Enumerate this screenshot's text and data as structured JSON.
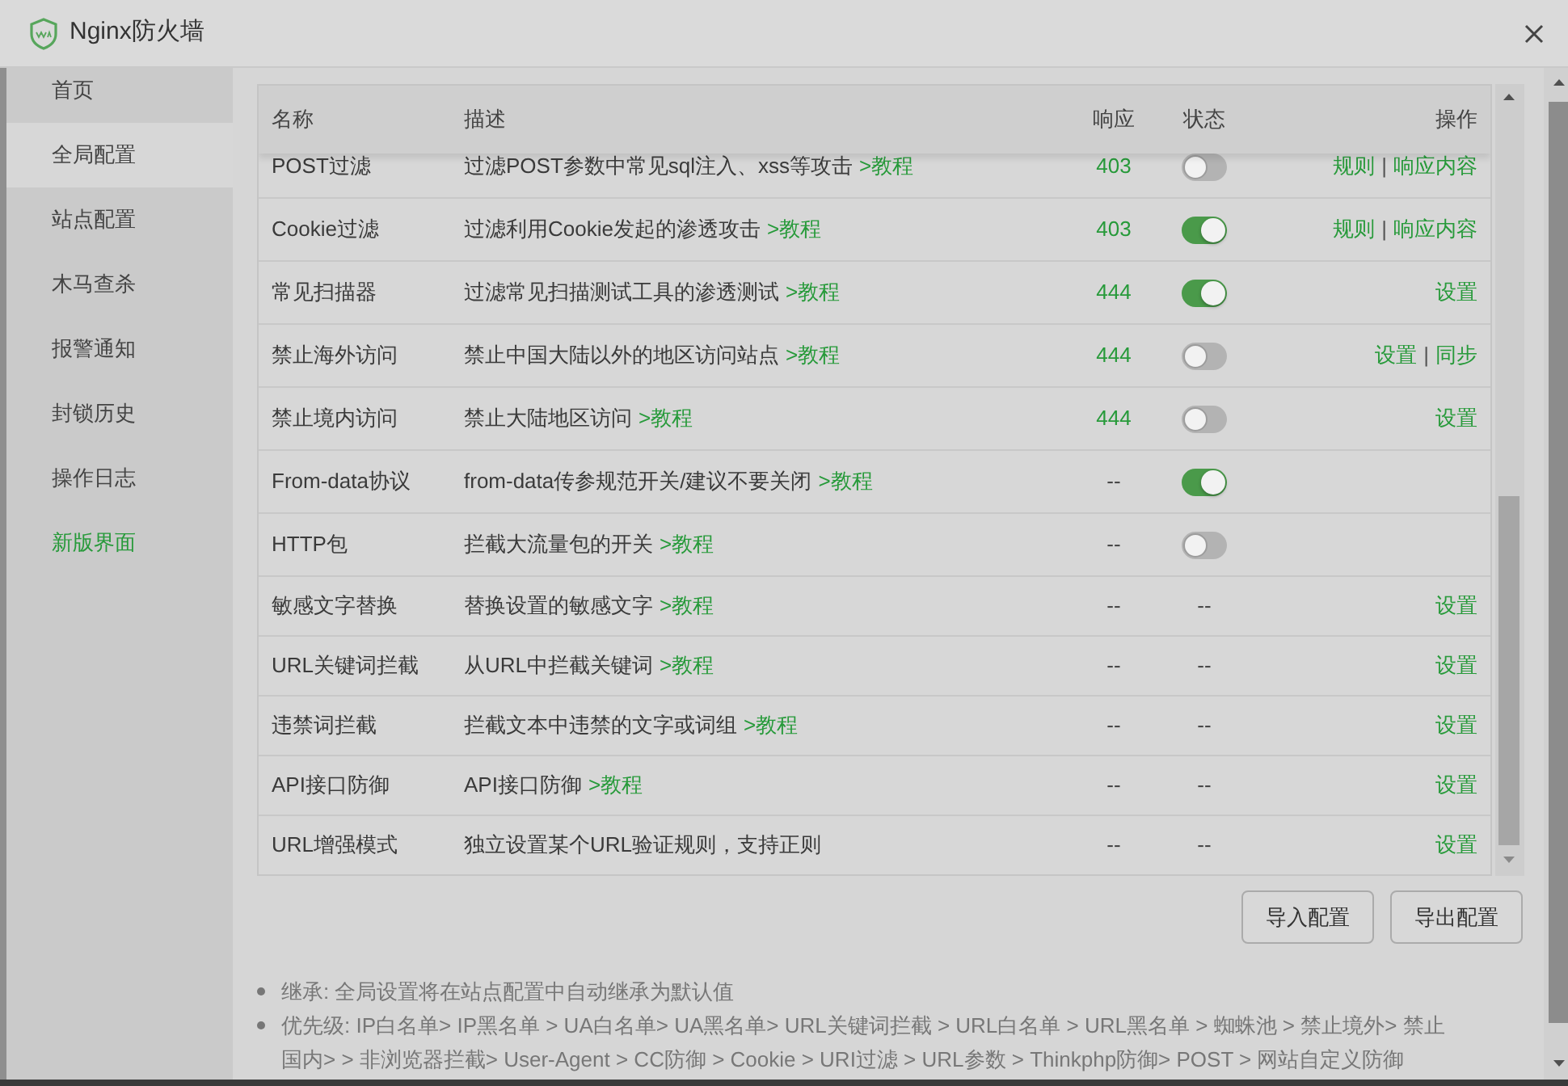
{
  "window": {
    "title": "Nginx防火墙"
  },
  "sidebar": {
    "items": [
      {
        "label": "首页",
        "selected": false,
        "highlighted": false
      },
      {
        "label": "全局配置",
        "selected": true,
        "highlighted": false
      },
      {
        "label": "站点配置",
        "selected": false,
        "highlighted": false
      },
      {
        "label": "木马查杀",
        "selected": false,
        "highlighted": false
      },
      {
        "label": "报警通知",
        "selected": false,
        "highlighted": false
      },
      {
        "label": "封锁历史",
        "selected": false,
        "highlighted": false
      },
      {
        "label": "操作日志",
        "selected": false,
        "highlighted": false
      },
      {
        "label": "新版界面",
        "selected": false,
        "highlighted": true
      }
    ]
  },
  "table": {
    "columns": [
      "名称",
      "描述",
      "响应",
      "状态",
      "操作"
    ],
    "action_separator": "|",
    "rows": [
      {
        "name": "POST过滤",
        "description": "过滤POST参数中常见sql注入、xss等攻击",
        "link": ">教程",
        "response": {
          "text": "403",
          "kind": "code"
        },
        "status": {
          "kind": "toggle",
          "on": false
        },
        "actions": [
          "规则",
          "响应内容"
        ]
      },
      {
        "name": "Cookie过滤",
        "description": "过滤利用Cookie发起的渗透攻击",
        "link": ">教程",
        "response": {
          "text": "403",
          "kind": "code"
        },
        "status": {
          "kind": "toggle",
          "on": true
        },
        "actions": [
          "规则",
          "响应内容"
        ]
      },
      {
        "name": "常见扫描器",
        "description": "过滤常见扫描测试工具的渗透测试",
        "link": ">教程",
        "response": {
          "text": "444",
          "kind": "code"
        },
        "status": {
          "kind": "toggle",
          "on": true
        },
        "actions": [
          "设置"
        ]
      },
      {
        "name": "禁止海外访问",
        "description": "禁止中国大陆以外的地区访问站点",
        "link": ">教程",
        "response": {
          "text": "444",
          "kind": "code"
        },
        "status": {
          "kind": "toggle",
          "on": false
        },
        "actions": [
          "设置",
          "同步"
        ]
      },
      {
        "name": "禁止境内访问",
        "description": "禁止大陆地区访问",
        "link": ">教程",
        "response": {
          "text": "444",
          "kind": "code"
        },
        "status": {
          "kind": "toggle",
          "on": false
        },
        "actions": [
          "设置"
        ]
      },
      {
        "name": "From-data协议",
        "description": "from-data传参规范开关/建议不要关闭",
        "link": ">教程",
        "response": {
          "text": "--",
          "kind": "none"
        },
        "status": {
          "kind": "toggle",
          "on": true
        }
      },
      {
        "name": "HTTP包",
        "description": "拦截大流量包的开关",
        "link": ">教程",
        "response": {
          "text": "--",
          "kind": "none"
        },
        "status": {
          "kind": "toggle",
          "on": false
        }
      },
      {
        "name": "敏感文字替换",
        "description": "替换设置的敏感文字",
        "link": ">教程",
        "response": {
          "text": "--",
          "kind": "none"
        },
        "status": {
          "kind": "text",
          "text": "--"
        },
        "actions": [
          "设置"
        ]
      },
      {
        "name": "URL关键词拦截",
        "description": "从URL中拦截关键词",
        "link": ">教程",
        "response": {
          "text": "--",
          "kind": "none"
        },
        "status": {
          "kind": "text",
          "text": "--"
        },
        "actions": [
          "设置"
        ]
      },
      {
        "name": "违禁词拦截",
        "description": "拦截文本中违禁的文字或词组",
        "link": ">教程",
        "response": {
          "text": "--",
          "kind": "none"
        },
        "status": {
          "kind": "text",
          "text": "--"
        },
        "actions": [
          "设置"
        ]
      },
      {
        "name": "API接口防御",
        "description": "API接口防御",
        "link": ">教程",
        "response": {
          "text": "--",
          "kind": "none"
        },
        "status": {
          "kind": "text",
          "text": "--"
        },
        "actions": [
          "设置"
        ]
      },
      {
        "name": "URL增强模式",
        "description": "独立设置某个URL验证规则，支持正则",
        "response": {
          "text": "--",
          "kind": "none"
        },
        "status": {
          "kind": "text",
          "text": "--"
        },
        "actions": [
          "设置"
        ]
      }
    ]
  },
  "buttons": [
    "导入配置",
    "导出配置"
  ],
  "notes": [
    "继承: 全局设置将在站点配置中自动继承为默认值",
    "优先级: IP白名单> IP黑名单 > UA白名单> UA黑名单> URL关键词拦截 > URL白名单 > URL黑名单 > 蜘蛛池 > 禁止境外> 禁止国内> > 非浏览器拦截> User-Agent > CC防御 > Cookie > URI过滤 > URL参数 > Thinkphp防御> POST > 网站自定义防御"
  ]
}
